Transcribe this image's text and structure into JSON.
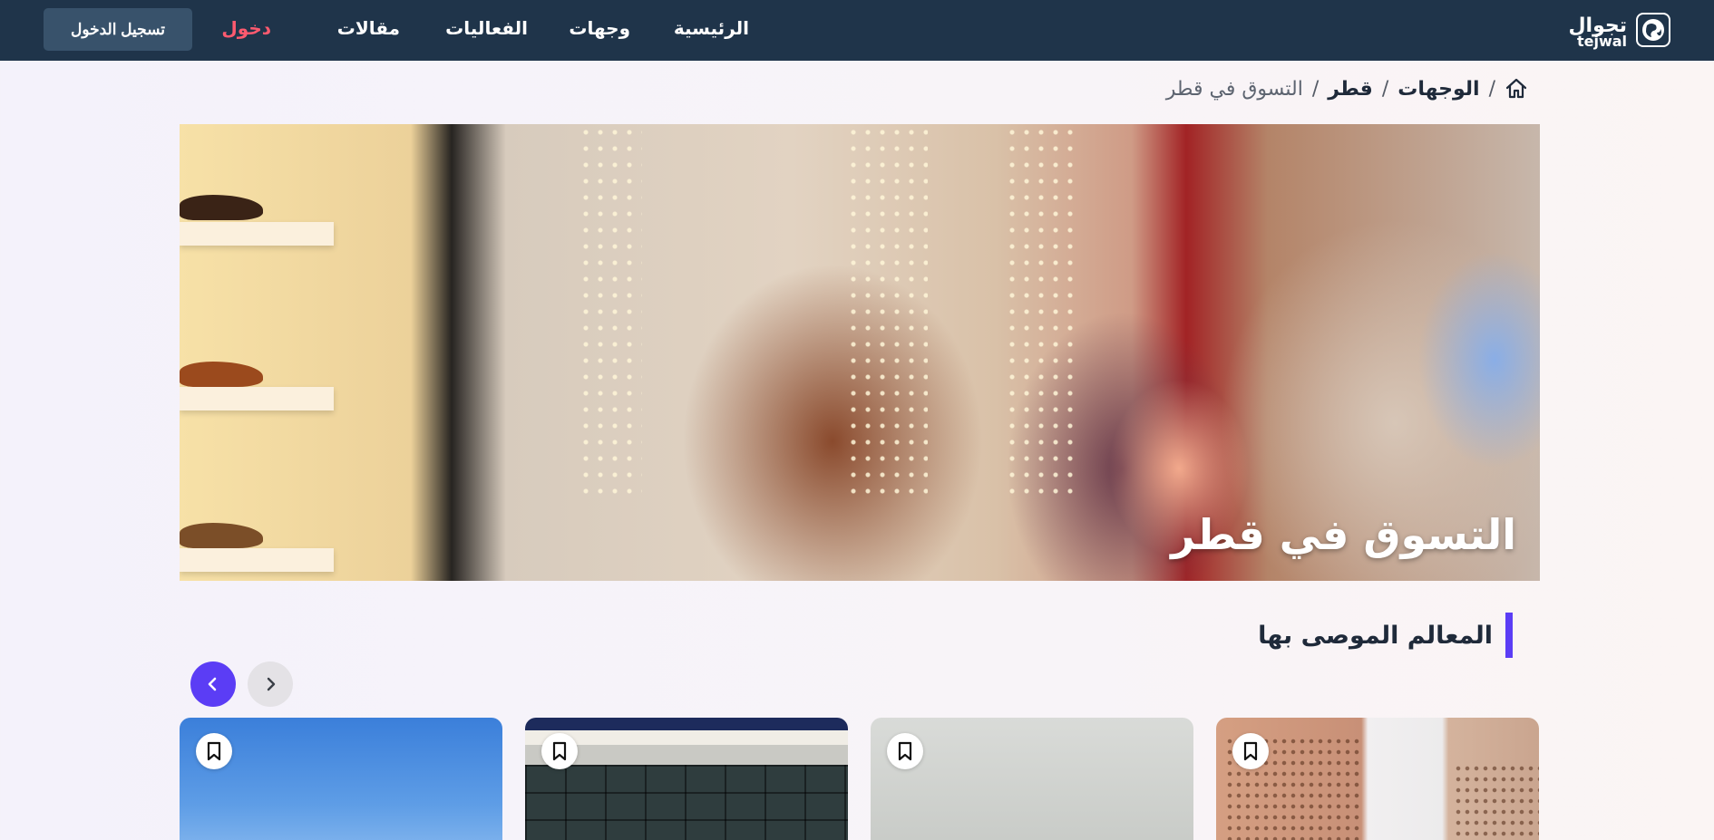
{
  "navbar": {
    "logo": {
      "arabic": "تجوال",
      "latin": "tejwal"
    },
    "links": {
      "home": "الرئيسية",
      "destinations": "وجهات",
      "events": "الفعاليات",
      "articles": "مقالات",
      "login": "دخول"
    },
    "register_label": "تسجيل الدخول"
  },
  "breadcrumb": {
    "items": [
      "الوجهات",
      "قطر"
    ],
    "current": "التسوق في قطر",
    "separator": "/"
  },
  "hero": {
    "title": "التسوق في قطر"
  },
  "recommended": {
    "title": "المعالم الموصى بها",
    "cards_count": 4
  },
  "colors": {
    "navbar": "#1f344a",
    "accent": "#5b3df5",
    "login": "#ff5a6f",
    "register_button": "#38526b"
  },
  "icons": {
    "home": "home-icon",
    "prev": "chevron-left-icon",
    "next": "chevron-right-icon",
    "bookmark": "bookmark-icon"
  }
}
